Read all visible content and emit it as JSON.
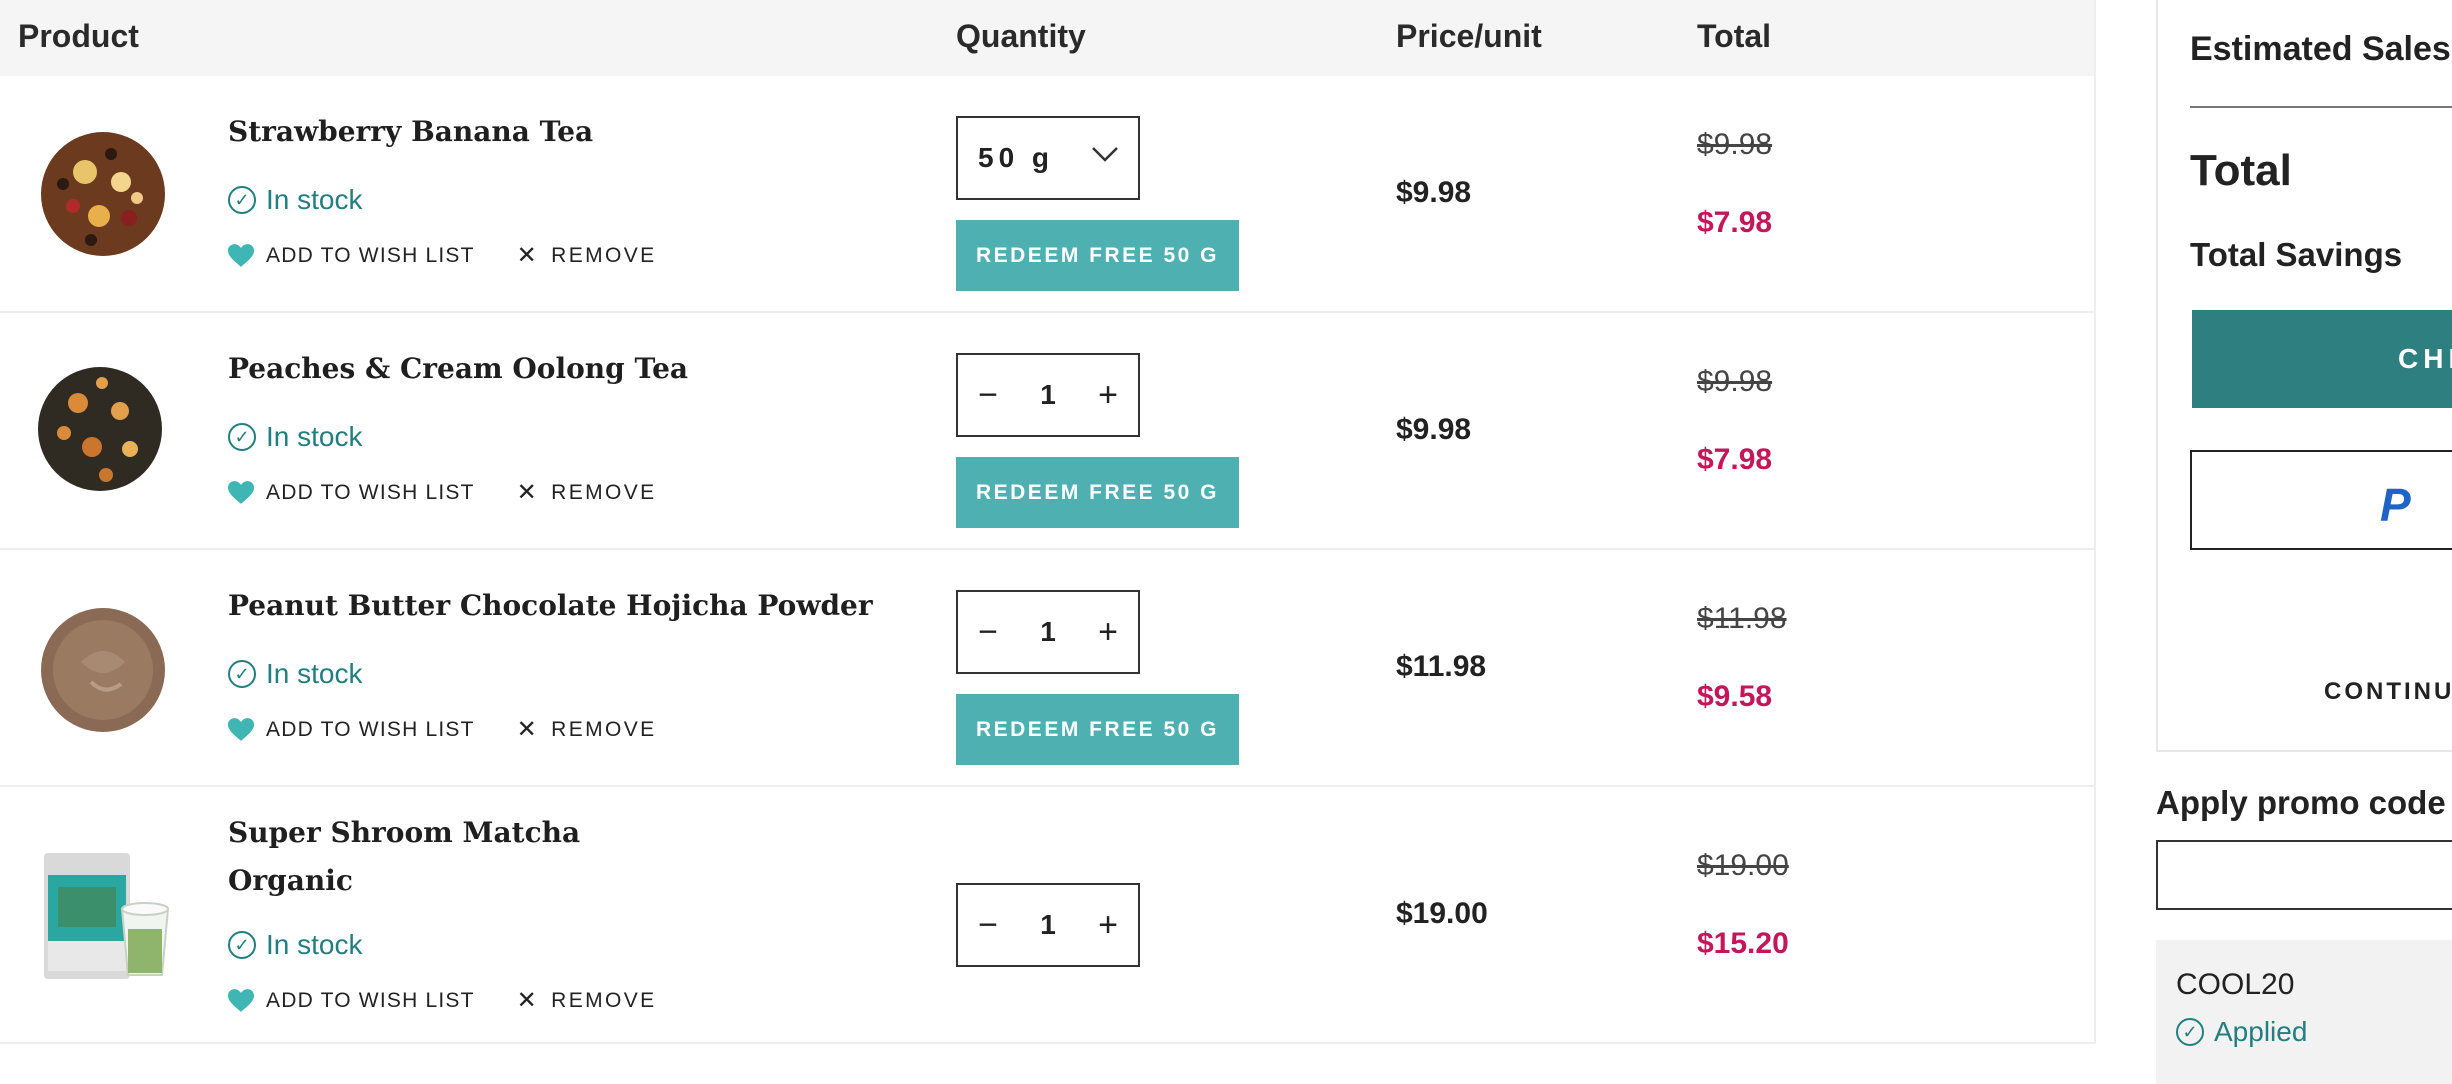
{
  "table": {
    "headers": {
      "product": "Product",
      "quantity": "Quantity",
      "price_unit": "Price/unit",
      "total": "Total"
    }
  },
  "items": [
    {
      "name": "Strawberry Banana Tea",
      "stock": "In stock",
      "wishlist": "ADD TO WISH LIST",
      "remove": "REMOVE",
      "quantity_type": "select",
      "quantity": "50 g",
      "redeem": "REDEEM FREE 50 G",
      "unit_price": "$9.98",
      "original_total": "$9.98",
      "sale_total": "$7.98"
    },
    {
      "name": "Peaches & Cream Oolong Tea",
      "stock": "In stock",
      "wishlist": "ADD TO WISH LIST",
      "remove": "REMOVE",
      "quantity_type": "stepper",
      "quantity": "1",
      "redeem": "REDEEM FREE 50 G",
      "unit_price": "$9.98",
      "original_total": "$9.98",
      "sale_total": "$7.98"
    },
    {
      "name": "Peanut Butter Chocolate Hojicha Powder",
      "stock": "In stock",
      "wishlist": "ADD TO WISH LIST",
      "remove": "REMOVE",
      "quantity_type": "stepper",
      "quantity": "1",
      "redeem": "REDEEM FREE 50 G",
      "unit_price": "$11.98",
      "original_total": "$11.98",
      "sale_total": "$9.58"
    },
    {
      "name": "Super Shroom Matcha Organic",
      "stock": "In stock",
      "wishlist": "ADD TO WISH LIST",
      "remove": "REMOVE",
      "quantity_type": "stepper",
      "quantity": "1",
      "unit_price": "$19.00",
      "original_total": "$19.00",
      "sale_total": "$15.20"
    }
  ],
  "summary": {
    "estimated": "Estimated Sales",
    "total": "Total",
    "savings": "Total Savings",
    "checkout": "CHE",
    "paypal": "P",
    "continue": "CONTINU"
  },
  "promo": {
    "label": "Apply promo code",
    "placeholder": "",
    "code": "COOL20",
    "status": "Applied"
  },
  "icons": {
    "check": "check-circle-icon",
    "heart": "heart-icon",
    "remove": "close-icon",
    "minus": "minus-icon",
    "plus": "plus-icon",
    "chevron": "chevron-down-icon",
    "paypal": "paypal-logo"
  },
  "colors": {
    "teal": "#237e80",
    "button_teal": "#4fb0b2",
    "checkout_teal": "#2e7f80",
    "sale_pink": "#c2185b",
    "heart": "#3fb5b4"
  }
}
